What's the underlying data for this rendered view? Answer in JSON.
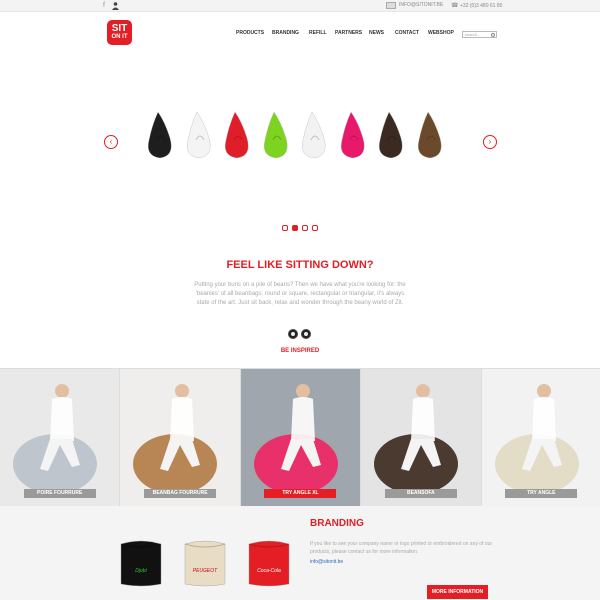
{
  "topbar": {
    "facebook_icon": "f",
    "email": "INFO@SITONIT.BE",
    "phone": "+32 (0)3 480 61 80"
  },
  "logo": {
    "line1": "SIT",
    "line2": "ON IT"
  },
  "nav": [
    "PRODUCTS",
    "BRANDING",
    "REFILL",
    "PARTNERS",
    "NEWS",
    "CONTACT",
    "WEBSHOP"
  ],
  "search": {
    "placeholder": "search..."
  },
  "slider": {
    "bag_colors": [
      "#1e1e1e",
      "#f4f4f4",
      "#e01e2a",
      "#7ed321",
      "#f2f2f2",
      "#e8196b",
      "#3a2a22",
      "#6b4a2b"
    ],
    "prev_icon": "‹",
    "next_icon": "›",
    "pages": 4,
    "active_page": 1
  },
  "intro": {
    "title": "FEEL LIKE SITTING DOWN?",
    "body": "Putting your buns on a pile of beans? Then we have what you're looking for: the 'beanies' of all beanbags: round or square, rectangular or triangular, it's always state of the art. Just sit back, relax and wonder through the beany world of Zit.",
    "cta": "BE INSPIRED"
  },
  "gallery": [
    {
      "label": "POIRE FOURRURE",
      "active": false,
      "bg": "#e9e9e9",
      "seat": "#bfc5cc"
    },
    {
      "label": "BEANBAG FOURRURE",
      "active": false,
      "bg": "#f0eeec",
      "seat": "#b88654"
    },
    {
      "label": "TRY ANGLE XL",
      "active": true,
      "bg": "#9fa6ad",
      "seat": "#e8316a"
    },
    {
      "label": "BEANSOFA",
      "active": false,
      "bg": "#e4e4e4",
      "seat": "#4b3a30"
    },
    {
      "label": "TRY ANGLE",
      "active": false,
      "bg": "#f2f2f2",
      "seat": "#e3dcc6"
    }
  ],
  "branding": {
    "title": "BRANDING",
    "body": "If you like to see your company name or logo printed or embroidered on any of our products, please contact us for more information.",
    "email": "info@sitonit.be",
    "button": "MORE INFORMATION",
    "cubes": [
      {
        "color": "#111111",
        "brand": "Djobi"
      },
      {
        "color": "#e8ddc4",
        "brand": "PEUGEOT"
      },
      {
        "color": "#e31e24",
        "brand": "Coca-Cola"
      }
    ]
  }
}
